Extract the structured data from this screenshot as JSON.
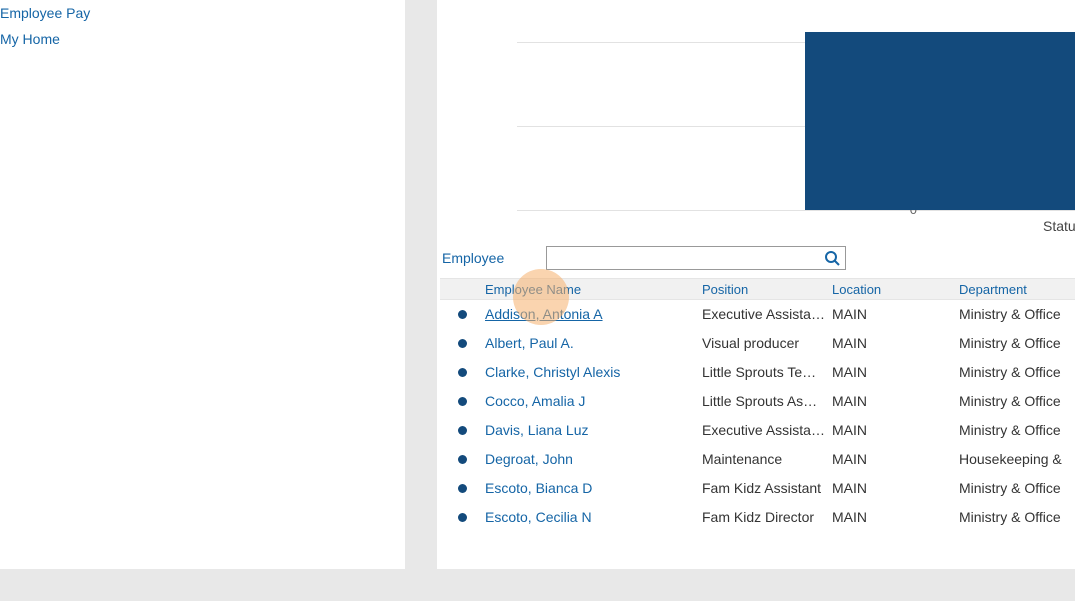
{
  "sidebar": {
    "items": [
      {
        "label": "Employee Pay"
      },
      {
        "label": "My Home"
      }
    ]
  },
  "chart_data": {
    "type": "bar",
    "categories": [
      "Status"
    ],
    "values": [
      23
    ],
    "title": "",
    "xlabel": "Status",
    "ylabel": "",
    "ylim": [
      0,
      23
    ],
    "yticks": [
      0,
      10,
      20
    ],
    "bar_color": "#134a7c"
  },
  "search": {
    "label": "Employee",
    "value": "",
    "placeholder": ""
  },
  "table": {
    "headers": {
      "name": "Employee Name",
      "position": "Position",
      "location": "Location",
      "department": "Department"
    },
    "rows": [
      {
        "name": "Addison, Antonia A",
        "position": "Executive Assista…",
        "location": "MAIN",
        "department": "Ministry & Office",
        "hovered": true
      },
      {
        "name": "Albert, Paul A.",
        "position": "Visual producer",
        "location": "MAIN",
        "department": "Ministry & Office"
      },
      {
        "name": "Clarke, Christyl Alexis",
        "position": "Little Sprouts Te…",
        "location": "MAIN",
        "department": "Ministry & Office"
      },
      {
        "name": "Cocco, Amalia J",
        "position": "Little Sprouts As…",
        "location": "MAIN",
        "department": "Ministry & Office"
      },
      {
        "name": "Davis, Liana Luz",
        "position": "Executive Assista…",
        "location": "MAIN",
        "department": "Ministry & Office"
      },
      {
        "name": "Degroat, John",
        "position": "Maintenance",
        "location": "MAIN",
        "department": "Housekeeping &"
      },
      {
        "name": "Escoto, Bianca D",
        "position": "Fam Kidz Assistant",
        "location": "MAIN",
        "department": "Ministry & Office"
      },
      {
        "name": "Escoto, Cecilia N",
        "position": "Fam Kidz Director",
        "location": "MAIN",
        "department": "Ministry & Office"
      }
    ]
  }
}
